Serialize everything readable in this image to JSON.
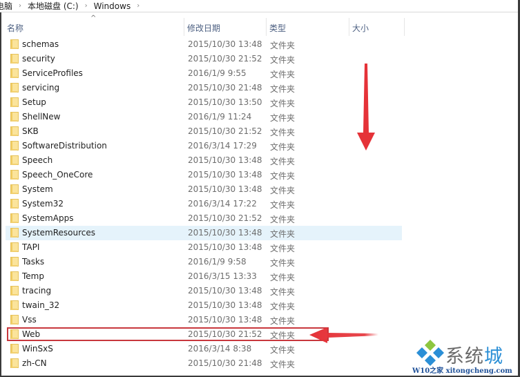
{
  "breadcrumb": {
    "items": [
      "电脑",
      "本地磁盘 (C:)",
      "Windows"
    ],
    "separator": "›"
  },
  "columns": {
    "name": "名称",
    "modified": "修改日期",
    "type": "类型",
    "size": "大小",
    "sort_indicator": "^"
  },
  "files": [
    {
      "name": "schemas",
      "modified": "2015/10/30 13:48",
      "type": "文件夹"
    },
    {
      "name": "security",
      "modified": "2015/10/30 21:52",
      "type": "文件夹"
    },
    {
      "name": "ServiceProfiles",
      "modified": "2016/1/9 9:55",
      "type": "文件夹"
    },
    {
      "name": "servicing",
      "modified": "2015/10/30 21:48",
      "type": "文件夹"
    },
    {
      "name": "Setup",
      "modified": "2015/10/30 13:50",
      "type": "文件夹"
    },
    {
      "name": "ShellNew",
      "modified": "2016/1/9 11:24",
      "type": "文件夹"
    },
    {
      "name": "SKB",
      "modified": "2015/10/30 21:52",
      "type": "文件夹"
    },
    {
      "name": "SoftwareDistribution",
      "modified": "2016/3/14 17:29",
      "type": "文件夹"
    },
    {
      "name": "Speech",
      "modified": "2015/10/30 13:48",
      "type": "文件夹"
    },
    {
      "name": "Speech_OneCore",
      "modified": "2015/10/30 13:48",
      "type": "文件夹"
    },
    {
      "name": "System",
      "modified": "2015/10/30 13:48",
      "type": "文件夹"
    },
    {
      "name": "System32",
      "modified": "2016/3/14 17:22",
      "type": "文件夹"
    },
    {
      "name": "SystemApps",
      "modified": "2015/10/30 21:52",
      "type": "文件夹"
    },
    {
      "name": "SystemResources",
      "modified": "2015/10/30 13:48",
      "type": "文件夹",
      "hovered": true
    },
    {
      "name": "TAPI",
      "modified": "2015/10/30 13:48",
      "type": "文件夹"
    },
    {
      "name": "Tasks",
      "modified": "2016/1/9 9:58",
      "type": "文件夹"
    },
    {
      "name": "Temp",
      "modified": "2016/3/15 13:33",
      "type": "文件夹"
    },
    {
      "name": "tracing",
      "modified": "2015/10/30 13:48",
      "type": "文件夹"
    },
    {
      "name": "twain_32",
      "modified": "2015/10/30 13:48",
      "type": "文件夹"
    },
    {
      "name": "Vss",
      "modified": "2015/10/30 13:48",
      "type": "文件夹"
    },
    {
      "name": "Web",
      "modified": "2015/10/30 21:52",
      "type": "文件夹",
      "annotated": true
    },
    {
      "name": "WinSxS",
      "modified": "2016/3/14 8:38",
      "type": "文件夹"
    },
    {
      "name": "zh-CN",
      "modified": "2015/10/30 21:48",
      "type": "文件夹"
    }
  ],
  "annotations": {
    "highlight_color": "#c8373c",
    "arrow_color": "#e53238"
  },
  "watermark": {
    "brand_gray": "系统",
    "brand_blue": "城",
    "url": "W10之家 xitongcheng.com",
    "colors": {
      "green": "#8dc63f",
      "blue": "#2b8fd6"
    }
  }
}
